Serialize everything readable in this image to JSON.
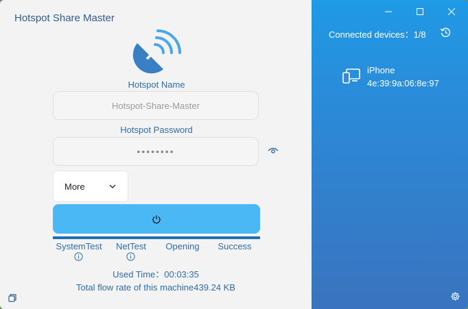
{
  "app": {
    "title": "Hotspot Share Master"
  },
  "form": {
    "name_label": "Hotspot Name",
    "name_placeholder": "Hotspot-Share-Master",
    "password_label": "Hotspot Password",
    "password_value": "••••••••",
    "more_label": "More"
  },
  "steps": [
    {
      "label": "SystemTest"
    },
    {
      "label": "NetTest"
    },
    {
      "label": "Opening"
    },
    {
      "label": "Success"
    }
  ],
  "status": {
    "used_time": "Used Time：00:03:35",
    "flow": "Total flow rate of this machine439.24 KB"
  },
  "devices": {
    "connected_label": "Connected devices：1/8",
    "items": [
      {
        "name": "iPhone",
        "mac": "4e:39:9a:06:8e:97"
      }
    ]
  },
  "icons": {
    "logo": "satellite-dish-icon",
    "eye": "eye-icon",
    "chevron": "chevron-down-icon",
    "power": "power-icon",
    "info": "info-icon",
    "restore": "restore-icon",
    "minimize": "minimize-icon",
    "maximize": "maximize-icon",
    "close": "close-icon",
    "history": "history-icon",
    "device": "device-icon",
    "settings": "gear-icon"
  },
  "colors": {
    "accent": "#4ab8f5",
    "panel_top": "#1f9ae6",
    "panel_bottom": "#3a73bf",
    "text_blue": "#2f6ca8"
  }
}
